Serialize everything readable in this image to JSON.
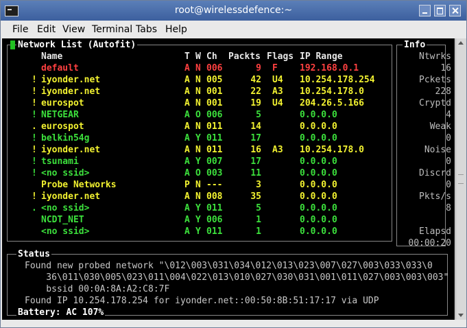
{
  "window": {
    "title": "root@wirelessdefence:~"
  },
  "menu": [
    "File",
    "Edit",
    "View",
    "Terminal",
    "Tabs",
    "Help"
  ],
  "network_list": {
    "title": "Network List  (Autofit)",
    "headers": {
      "name": "Name",
      "t": "T",
      "w": "W",
      "ch": "Ch",
      "packts": "Packts",
      "flags": "Flags",
      "ip": "IP Range"
    },
    "rows": [
      {
        "mark": "",
        "name": "default",
        "t": "A",
        "w": "N",
        "ch": "006",
        "packts": "9",
        "flags": "F",
        "ip": "192.168.0.1",
        "color": "red"
      },
      {
        "mark": "!",
        "name": "iyonder.net",
        "t": "A",
        "w": "N",
        "ch": "005",
        "packts": "42",
        "flags": "U4",
        "ip": "10.254.178.254",
        "color": "yellow"
      },
      {
        "mark": "!",
        "name": "iyonder.net",
        "t": "A",
        "w": "N",
        "ch": "001",
        "packts": "22",
        "flags": "A3",
        "ip": "10.254.178.0",
        "color": "yellow"
      },
      {
        "mark": "!",
        "name": "eurospot",
        "t": "A",
        "w": "N",
        "ch": "001",
        "packts": "19",
        "flags": "U4",
        "ip": "204.26.5.166",
        "color": "yellow"
      },
      {
        "mark": "!",
        "name": "NETGEAR",
        "t": "A",
        "w": "O",
        "ch": "006",
        "packts": "5",
        "flags": "",
        "ip": "0.0.0.0",
        "color": "green"
      },
      {
        "mark": ".",
        "name": "eurospot",
        "t": "A",
        "w": "N",
        "ch": "011",
        "packts": "14",
        "flags": "",
        "ip": "0.0.0.0",
        "color": "yellow"
      },
      {
        "mark": "!",
        "name": "belkin54g",
        "t": "A",
        "w": "Y",
        "ch": "011",
        "packts": "17",
        "flags": "",
        "ip": "0.0.0.0",
        "color": "green"
      },
      {
        "mark": "!",
        "name": "iyonder.net",
        "t": "A",
        "w": "N",
        "ch": "011",
        "packts": "16",
        "flags": "A3",
        "ip": "10.254.178.0",
        "color": "yellow"
      },
      {
        "mark": "!",
        "name": "tsunami",
        "t": "A",
        "w": "Y",
        "ch": "007",
        "packts": "17",
        "flags": "",
        "ip": "0.0.0.0",
        "color": "green"
      },
      {
        "mark": "!",
        "name": "<no ssid>",
        "t": "A",
        "w": "O",
        "ch": "003",
        "packts": "11",
        "flags": "",
        "ip": "0.0.0.0",
        "color": "green"
      },
      {
        "mark": "",
        "name": "Probe Networks",
        "t": "P",
        "w": "N",
        "ch": "---",
        "packts": "3",
        "flags": "",
        "ip": "0.0.0.0",
        "color": "yellow"
      },
      {
        "mark": "!",
        "name": "iyonder.net",
        "t": "A",
        "w": "N",
        "ch": "008",
        "packts": "35",
        "flags": "",
        "ip": "0.0.0.0",
        "color": "yellow"
      },
      {
        "mark": ".",
        "name": "<no ssid>",
        "t": "A",
        "w": "Y",
        "ch": "011",
        "packts": "5",
        "flags": "",
        "ip": "0.0.0.0",
        "color": "green"
      },
      {
        "mark": "",
        "name": "NCDT_NET",
        "t": "A",
        "w": "Y",
        "ch": "006",
        "packts": "1",
        "flags": "",
        "ip": "0.0.0.0",
        "color": "green"
      },
      {
        "mark": "",
        "name": "<no ssid>",
        "t": "A",
        "w": "Y",
        "ch": "011",
        "packts": "1",
        "flags": "",
        "ip": "0.0.0.0",
        "color": "green"
      }
    ]
  },
  "info": {
    "title": "Info",
    "items": [
      {
        "label": "Ntwrks",
        "value": "16"
      },
      {
        "label": "Pckets",
        "value": "228"
      },
      {
        "label": "Cryptd",
        "value": "4"
      },
      {
        "label": "Weak",
        "value": "0"
      },
      {
        "label": "Noise",
        "value": "0"
      },
      {
        "label": "Discrd",
        "value": "0"
      },
      {
        "label": "Pkts/s",
        "value": "8"
      }
    ],
    "elapsed_label": "Elapsd",
    "elapsed_value": "00:00:20"
  },
  "status": {
    "title": "Status",
    "lines": [
      "Found new probed network \"\\012\\003\\031\\034\\012\\013\\023\\007\\027\\003\\033\\033\\0",
      "    36\\011\\030\\005\\023\\011\\004\\022\\013\\010\\027\\030\\031\\001\\011\\027\\003\\003\\003\"",
      "    bssid 00:0A:8A:A2:C8:7F",
      "Found IP 10.254.178.254 for iyonder.net::00:50:8B:51:17:17 via UDP"
    ]
  },
  "battery": "Battery: AC 107%",
  "colors": {
    "red": "#ff4040",
    "yellow": "#f2f230",
    "green": "#3ce03c",
    "titlebar": "#4a6fae"
  }
}
